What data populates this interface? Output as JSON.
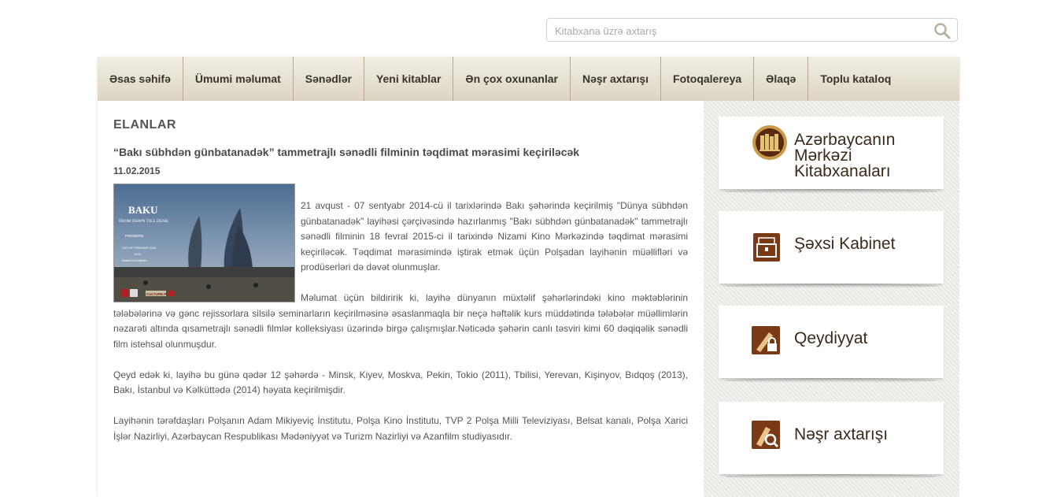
{
  "search": {
    "placeholder": "Kitabxana üzrə axtarış"
  },
  "nav": [
    {
      "label": "Əsas səhifə"
    },
    {
      "label": "Ümumi məlumat"
    },
    {
      "label": "Sənədlər"
    },
    {
      "label": "Yeni kitablar"
    },
    {
      "label": "Ən çox oxunanlar"
    },
    {
      "label": "Nəşr axtarışı"
    },
    {
      "label": "Fotoqalereya"
    },
    {
      "label": "Əlaqə"
    },
    {
      "label": "Toplu kataloq"
    }
  ],
  "main": {
    "section_title": "ELANLAR",
    "article": {
      "title": "“Bakı sübhdən günbatanadək” tammetrajlı sənədli filminin təqdimat mərasimi keçiriləcək",
      "date": "11.02.2015",
      "poster": {
        "title": "BAKU",
        "subtitle": "FROM DAWN TILL DUSK",
        "premiere": "PREMIERE",
        "date_line": "18TH OF FEBRUARY 2015",
        "time": "19:00",
        "venue": "Nizami Kino Markazi",
        "brand": "CULTURE.PL"
      },
      "paragraphs": [
        "21 avqust - 07 sentyabr 2014-cü il tarixlərində Bakı şəhərində keçirilmiş \"Dünya sübhdən günbatanadək\" layihəsi çərçivəsində hazırlanmış \"Bakı sübhdən günbatanadək\" tammetrajlı sənədli filminin 18 fevral 2015-ci il tarixində Nizami Kino Mərkəzində təqdimat mərasimi keçiriləcək. Təqdimat mərasimində iştirak etmək üçün Polşadan layihənin müəllifləri və prodüserləri də dəvət olunmuşlar.",
        "Məlumat üçün bildiririk ki, layihə dünyanın müxtəlif şəhərlərindəki kino məktəblərinin tələbələrinə və gənc rejissorlara silsilə seminarların keçirilməsinə əsaslanmaqla bir neçə həftəlik kurs müddətində tələbələr müəllimlərin nəzarəti altında qısametrajlı sənədli filmlər kolleksiyası üzərində birgə çalışmışlar.Nəticədə şəhərin canlı təsviri kimi 60 dəqiqəlik sənədli film istehsal olunmuşdur.",
        "Qeyd edək ki, layihə bu günə qədər 12 şəhərdə - Minsk, Kiyev, Moskva, Pekin, Tokio (2011), Tbilisi, Yerevan, Kişinyov, Bıdqoş (2013), Bakı, İstanbul və Kəlküttədə (2014) həyata keçirilmişdir.",
        "Layihənin tərəfdaşları Polşanın Adam Mikiyeviç İnstitutu, Polşa Kino İnstitutu, TVP 2 Polşa Milli Televiziyası, Belsat kanalı, Polşa Xarici İşlər Nazirliyi, Azərbaycan Respublikası Mədəniyyət və Turizm Nazirliyi və Azanfilm studiyasıdır."
      ]
    }
  },
  "sidebar": {
    "cards": [
      {
        "label": "Azərbaycanın Mərkəzi Kitabxanaları",
        "icon": "library-books-icon"
      },
      {
        "label": "Şəxsi Kabinet",
        "icon": "briefcase-icon"
      },
      {
        "label": "Qeydiyyat",
        "icon": "pen-lock-icon"
      },
      {
        "label": "Nəşr axtarışı",
        "icon": "book-search-icon"
      }
    ]
  },
  "colors": {
    "nav_bg": "#e6dfd0",
    "icon_brown": "#7a3a15",
    "sidebar_bg": "#eeece8"
  }
}
